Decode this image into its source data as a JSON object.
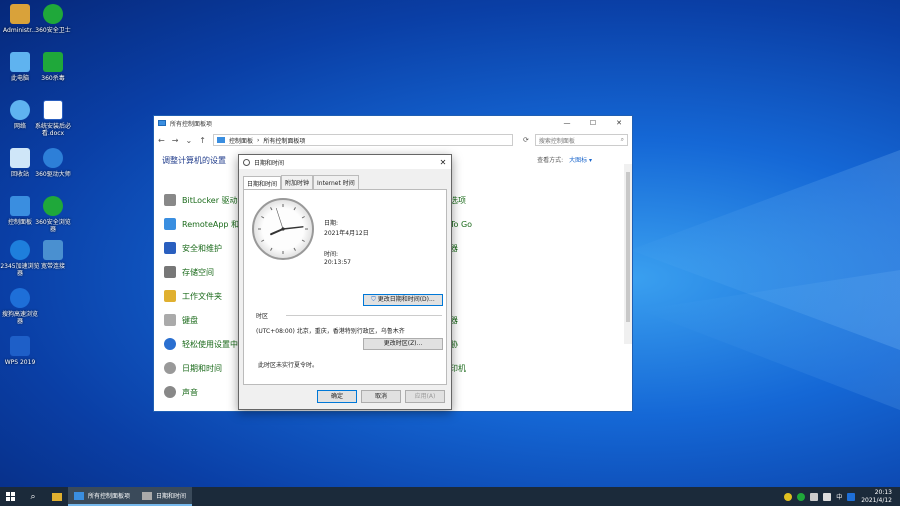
{
  "desktop": {
    "icons": [
      {
        "label": "Administr...",
        "color": "#d9a23a"
      },
      {
        "label": "360安全卫士",
        "color": "#1fa83a"
      },
      {
        "label": "此电脑",
        "color": "#5fb3f0"
      },
      {
        "label": "360杀毒",
        "color": "#1fa83a"
      },
      {
        "label": "网络",
        "color": "#5fb3f0"
      },
      {
        "label": "系统安装后必看.docx",
        "color": "#ffffff"
      },
      {
        "label": "回收站",
        "color": "#cfe6f8"
      },
      {
        "label": "360驱动大师",
        "color": "#2d7fd8"
      },
      {
        "label": "控制面板",
        "color": "#3a8ee0"
      },
      {
        "label": "360安全浏览器",
        "color": "#1fa83a"
      },
      {
        "label": "2345加速浏览器",
        "color": "#1e7fdc"
      },
      {
        "label": "宽带连接",
        "color": "#4a90d0"
      },
      {
        "label": "搜狗高速浏览器",
        "color": "#1e6fd8"
      },
      {
        "label": "WPS 2019",
        "color": "#1e5fc8"
      }
    ]
  },
  "explorer": {
    "title": "所有控制面板项",
    "controls": [
      "—",
      "☐",
      "✕"
    ],
    "address": [
      "控制面板",
      "›",
      "所有控制面板项"
    ],
    "search_placeholder": "搜索控制面板",
    "adjust_title": "调整计算机的设置",
    "view_by_label": "查看方式:",
    "view_by_value": "大图标 ▾",
    "items_left": [
      {
        "label": "BitLocker 驱动器",
        "color": "#888888"
      },
      {
        "label": "RemoteApp 和桌",
        "color": "#3a8ee0"
      },
      {
        "label": "安全和维护",
        "color": "#2a5fbf"
      },
      {
        "label": "存储空间",
        "color": "#777777"
      },
      {
        "label": "工作文件夹",
        "color": "#e0b030"
      },
      {
        "label": "键盘",
        "color": "#aaaaaa"
      },
      {
        "label": "轻松使用设置中",
        "color": "#2a6fd0"
      },
      {
        "label": "日期和时间",
        "color": "#999999"
      },
      {
        "label": "声音",
        "color": "#888888"
      }
    ],
    "items_right": [
      {
        "label": "选项"
      },
      {
        "label": "To Go"
      },
      {
        "label": "器"
      },
      {
        "label": ""
      },
      {
        "label": ""
      },
      {
        "label": "器"
      },
      {
        "label": "胁"
      },
      {
        "label": "印机"
      },
      {
        "label": ""
      }
    ]
  },
  "dialog": {
    "title": "日期和时间",
    "tabs": [
      "日期和时间",
      "附加时钟",
      "Internet 时间"
    ],
    "date_label": "日期:",
    "date_value": "2021年4月12日",
    "time_label": "时间:",
    "time_value": "20:13:57",
    "change_datetime": "更改日期和时间(D)...",
    "timezone_label": "时区",
    "timezone_value": "(UTC+08:00) 北京，重庆，香港特别行政区，乌鲁木齐",
    "change_timezone": "更改时区(Z)...",
    "dst_note": "此时区未实行夏令时。",
    "ok": "确定",
    "cancel": "取消",
    "apply": "应用(A)",
    "clock": {
      "hour": 8,
      "minute": 13,
      "second": 57
    }
  },
  "taskbar": {
    "buttons": [
      "所有控制面板项",
      "日期和时间"
    ],
    "time": "20:13",
    "date": "2021/4/12",
    "ime": "中"
  }
}
